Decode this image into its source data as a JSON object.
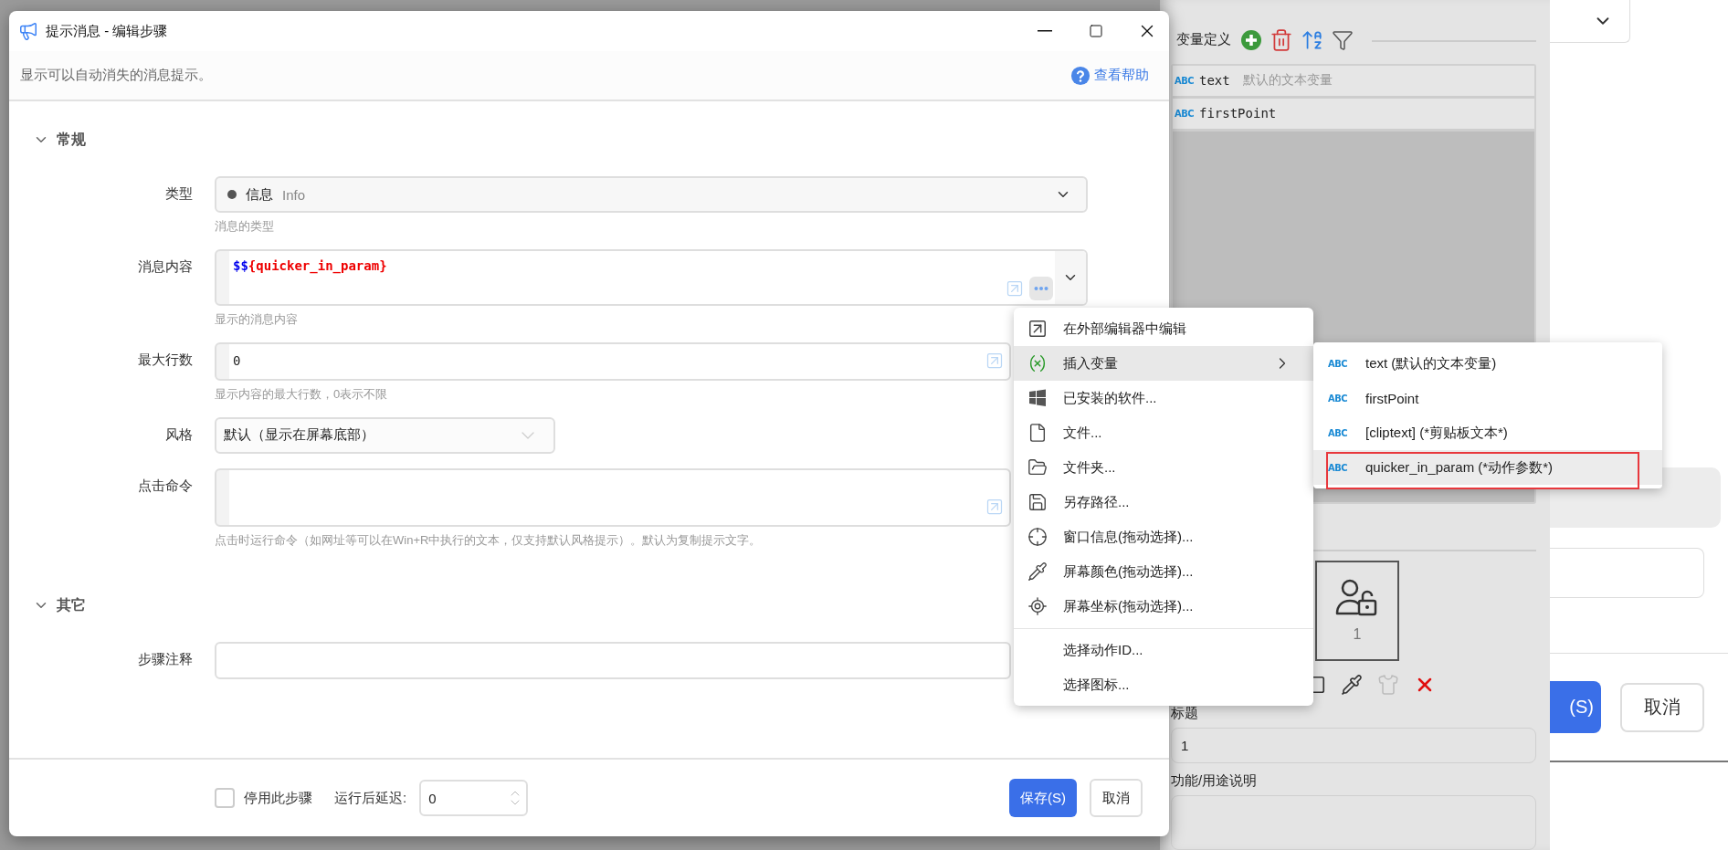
{
  "dialog": {
    "title": "提示消息 - 编辑步骤",
    "description": "显示可以自动消失的消息提示。",
    "help_link": "查看帮助",
    "sections": [
      {
        "title": "常规",
        "expanded": true,
        "fields": [
          {
            "kind": "select",
            "label": "类型",
            "value": "信息",
            "secondary": "Info",
            "hint": "消息的类型"
          },
          {
            "kind": "editor",
            "label": "消息内容",
            "prefix": "$$",
            "expression": "{quicker_in_param}",
            "hint": "显示的消息内容"
          },
          {
            "kind": "text",
            "label": "最大行数",
            "value": "0",
            "hint": "显示内容的最大行数，0表示不限"
          },
          {
            "kind": "dropdown",
            "label": "风格",
            "value": "默认（显示在屏幕底部）"
          },
          {
            "kind": "multiline",
            "label": "点击命令",
            "hint": "点击时运行命令（如网址等可以在Win+R中执行的文本，仅支持默认风格提示）。默认为复制提示文字。"
          }
        ]
      },
      {
        "title": "其它",
        "expanded": true,
        "fields": [
          {
            "kind": "plain",
            "label": "步骤注释"
          }
        ]
      }
    ],
    "footer": {
      "disable_step": {
        "label": "停用此步骤",
        "checked": false
      },
      "delay": {
        "label": "运行后延迟:",
        "value": "0"
      },
      "buttons": [
        {
          "label": "保存(S)",
          "primary": true
        },
        {
          "label": "取消",
          "primary": false
        }
      ]
    }
  },
  "context_menu": {
    "groups": [
      [
        {
          "label": "在外部编辑器中编辑",
          "selected": false,
          "submenu": false
        },
        {
          "label": "插入变量",
          "selected": true,
          "submenu": true
        },
        {
          "label": "已安装的软件...",
          "selected": false,
          "submenu": false
        },
        {
          "label": "文件...",
          "selected": false,
          "submenu": false
        },
        {
          "label": "文件夹...",
          "selected": false,
          "submenu": false
        },
        {
          "label": "另存路径...",
          "selected": false,
          "submenu": false
        },
        {
          "label": "窗口信息(拖动选择)...",
          "selected": false,
          "submenu": false
        },
        {
          "label": "屏幕颜色(拖动选择)...",
          "selected": false,
          "submenu": false
        },
        {
          "label": "屏幕坐标(拖动选择)...",
          "selected": false,
          "submenu": false
        }
      ],
      [
        {
          "label": "选择动作ID...",
          "selected": false,
          "submenu": false
        },
        {
          "label": "选择图标...",
          "selected": false,
          "submenu": false
        }
      ]
    ]
  },
  "submenu": {
    "items": [
      {
        "type": "ABC",
        "label": "text (默认的文本变量)",
        "selected": false,
        "annotated": false
      },
      {
        "type": "ABC",
        "label": "firstPoint",
        "selected": false,
        "annotated": false
      },
      {
        "type": "ABC",
        "label": "[cliptext] (*剪贴板文本*)",
        "selected": false,
        "annotated": false
      },
      {
        "type": "ABC",
        "label": "quicker_in_param (*动作参数*)",
        "selected": true,
        "annotated": true
      }
    ]
  },
  "variables_panel": {
    "title": "变量定义",
    "rows": [
      {
        "type": "ABC",
        "name": "text",
        "description": "默认的文本变量"
      },
      {
        "type": "ABC",
        "name": "firstPoint"
      }
    ],
    "tile_caption": "1",
    "title_label": "标题",
    "title_value": "1",
    "purpose_label": "功能/用途说明"
  },
  "right_panel": {
    "save_button": "(S)",
    "cancel_button": "取消"
  }
}
